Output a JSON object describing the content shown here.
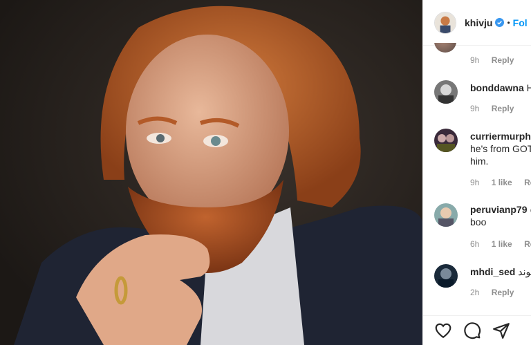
{
  "post": {
    "image_alt": "Portrait of a man with red hair and beard in a dark suit",
    "author": "khivju",
    "separator": "•",
    "follow_label": "Fol"
  },
  "top_meta": {
    "time": "9h",
    "reply": "Reply"
  },
  "comments": [
    {
      "user": "bonddawna",
      "text": "H",
      "time": "9h",
      "likes": "",
      "reply": "Reply"
    },
    {
      "user": "curriermurph",
      "text_line1": "he's from GOT",
      "text_line2": "him.",
      "time": "9h",
      "likes": "1 like",
      "reply": "Repl"
    },
    {
      "user": "peruvianp79",
      "text_tail": "@",
      "text_line1": "boo",
      "time": "6h",
      "likes": "1 like",
      "reply": "Repl"
    },
    {
      "user": "mhdi_sed",
      "text": "موند",
      "time": "2h",
      "likes": "",
      "reply": "Reply"
    }
  ],
  "icons": {
    "verified": "verified-badge-icon",
    "like": "heart-icon",
    "comment": "comment-icon",
    "share": "share-icon"
  },
  "colors": {
    "accent": "#0095f6",
    "text": "#262626",
    "muted": "#8e8e8e"
  }
}
